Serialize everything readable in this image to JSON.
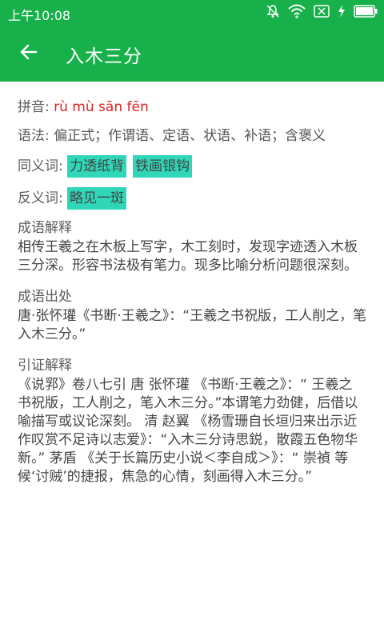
{
  "status_bar": {
    "time": "上午10:08"
  },
  "app_bar": {
    "title": "入木三分"
  },
  "pinyin": {
    "label": "拼音:",
    "value": "rù mù sān fēn"
  },
  "grammar": {
    "label": "语法:",
    "value": "偏正式；作谓语、定语、状语、补语；含褒义"
  },
  "synonyms": {
    "label": "同义词:",
    "items": [
      "力透纸背",
      "铁画银钩"
    ]
  },
  "antonyms": {
    "label": "反义词:",
    "items": [
      "略见一斑"
    ]
  },
  "explanation": {
    "title": "成语解释",
    "body": " 相传王羲之在木板上写字，木工刻时，发现字迹透入木板三分深。形容书法极有笔力。现多比喻分析问题很深刻。"
  },
  "source": {
    "title": "成语出处",
    "body": " 唐·张怀瓘《书断·王羲之》：“王羲之书祝版，工人削之，笔入木三分。”"
  },
  "citation": {
    "title": "引证解释",
    "body": "《说郛》卷八七引 唐 张怀瓘 《书断·王羲之》：“ 王羲之 书祝版，工人削之，笔入木三分。”本谓笔力劲健，后借以喻描写或议论深刻。 清 赵翼 《杨雪珊自长垣归来出示近作叹赏不足诗以志爱》：“入木三分诗思鋭，散霞五色物华新。” 茅盾 《关于长篇历史小说＜李自成＞》：“ 崇禎 等候‘讨贼’的捷报，焦急的心情，刻画得入木三分。”"
  }
}
